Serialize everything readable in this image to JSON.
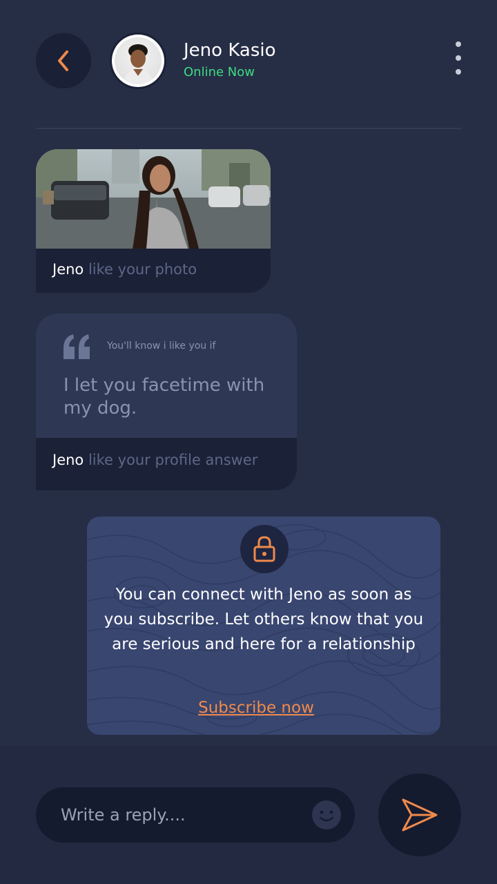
{
  "header": {
    "back_icon": "chevron-left-icon",
    "user_name": "Jeno Kasio",
    "status": "Online Now",
    "more_icon": "more-vertical-icon"
  },
  "messages": {
    "photo_like": {
      "name": "Jeno",
      "action": "like your photo"
    },
    "profile_answer": {
      "prompt": "You'll know i like you if",
      "answer": "I let you facetime with my dog.",
      "name": "Jeno",
      "action": "like your profile answer"
    }
  },
  "subscribe_card": {
    "icon": "lock-icon",
    "message": "You can connect with Jeno as soon as you subscribe. Let others know that you are serious and here for a relationship",
    "link_label": "Subscribe now"
  },
  "composer": {
    "placeholder": "Write a reply....",
    "emoji_icon": "emoji-icon",
    "send_icon": "send-icon"
  },
  "colors": {
    "background": "#262e45",
    "accent": "#f08a4b",
    "online": "#3ddc84",
    "card_dark": "#1b2136",
    "card_blue": "#394670"
  }
}
